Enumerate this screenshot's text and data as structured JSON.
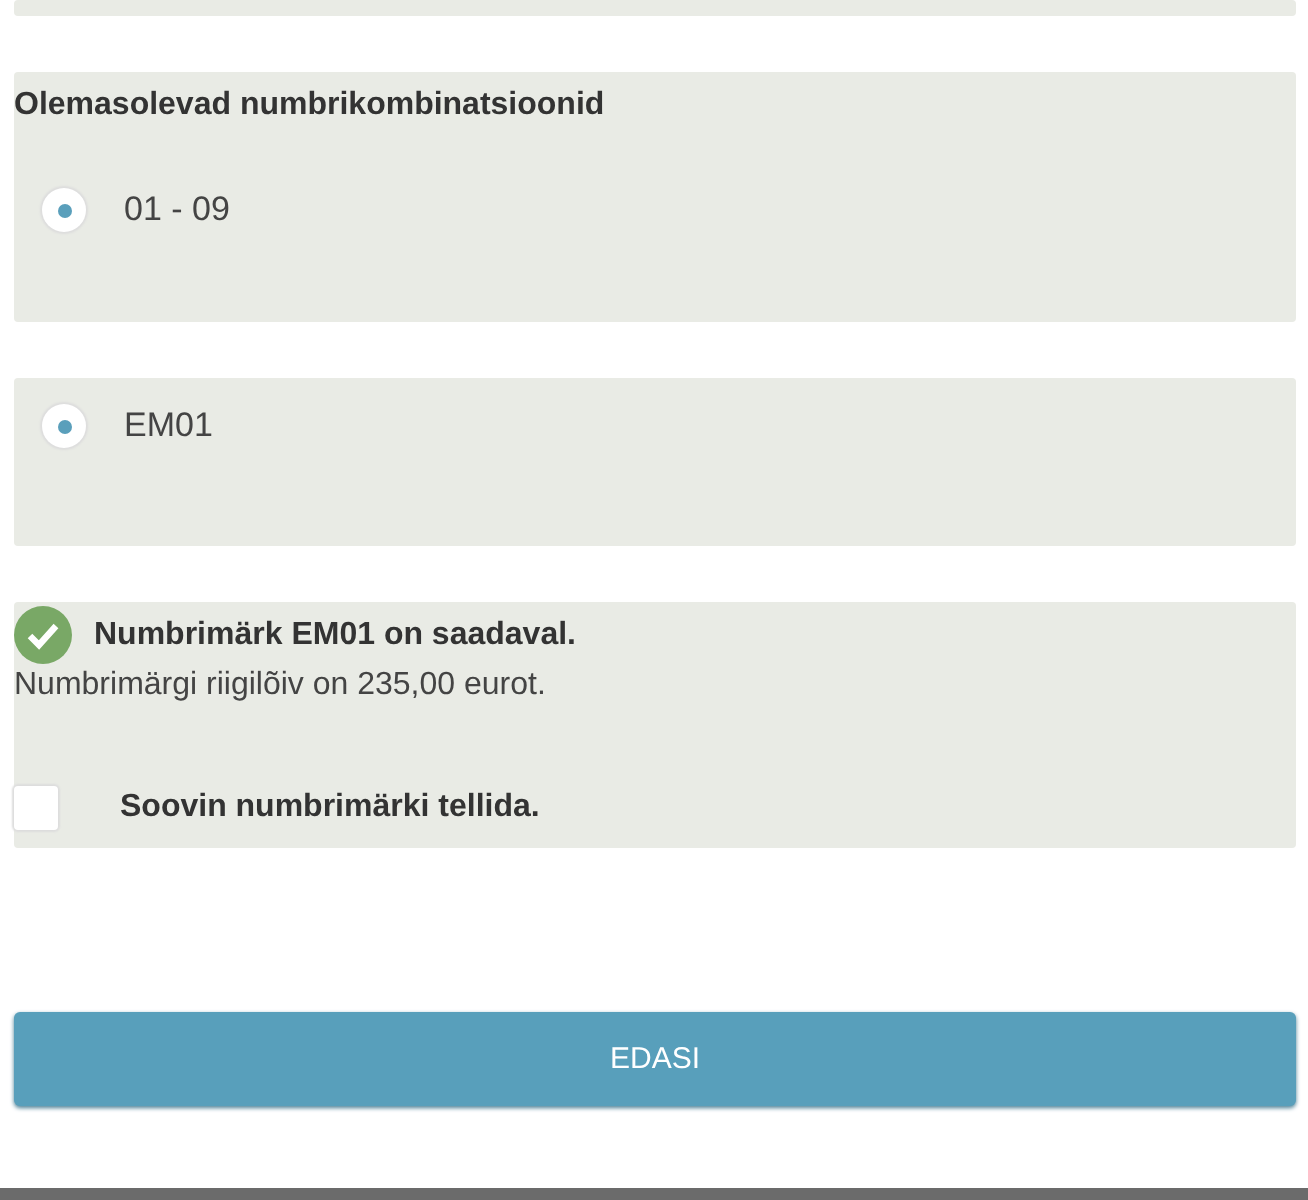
{
  "combinations": {
    "title": "Olemasolevad numbrikombinatsioonid",
    "options": [
      {
        "label": "01 - 09",
        "selected": true
      }
    ]
  },
  "plate_options": [
    {
      "label": "EM01",
      "selected": true
    }
  ],
  "availability": {
    "available": true,
    "message": "Numbrimärk EM01 on saadaval.",
    "fee": "Numbrimärgi riigilõiv on 235,00 eurot.",
    "order_checkbox": {
      "label": "Soovin numbrimärki tellida.",
      "checked": false
    }
  },
  "next_button": "EDASI"
}
